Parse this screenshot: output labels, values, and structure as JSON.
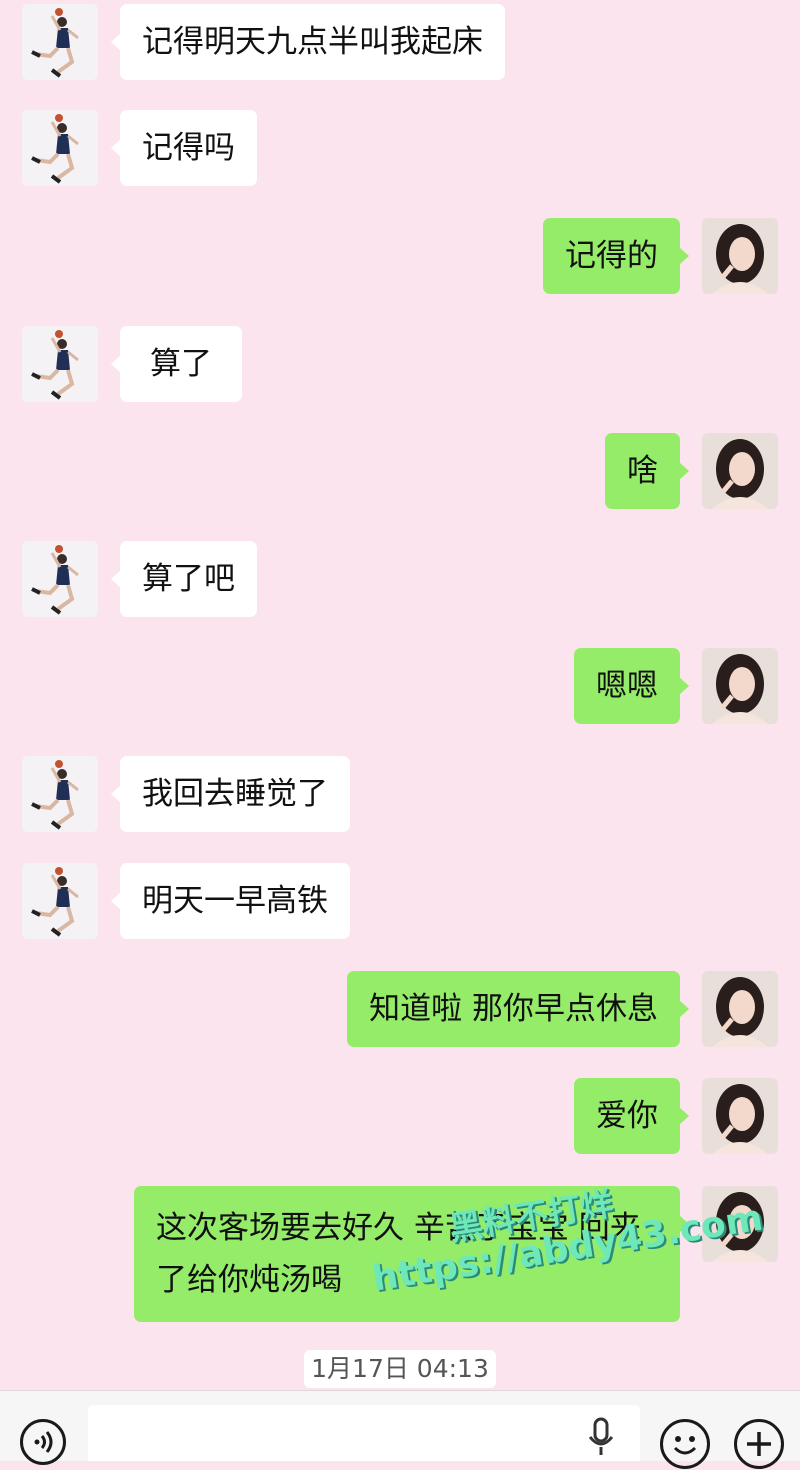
{
  "messages": [
    {
      "side": "left",
      "text": "记得明天九点半叫我起床"
    },
    {
      "side": "left",
      "text": "记得吗"
    },
    {
      "side": "right",
      "text": "记得的"
    },
    {
      "side": "left",
      "text": "算了"
    },
    {
      "side": "right",
      "text": "啥"
    },
    {
      "side": "left",
      "text": "算了吧"
    },
    {
      "side": "right",
      "text": "嗯嗯"
    },
    {
      "side": "left",
      "text": "我回去睡觉了"
    },
    {
      "side": "left",
      "text": "明天一早高铁"
    },
    {
      "side": "right",
      "text": "知道啦 那你早点休息"
    },
    {
      "side": "right",
      "text": "爱你"
    },
    {
      "side": "right",
      "text": "这次客场要去好久 辛苦了宝宝 回来了给你炖汤喝"
    }
  ],
  "timestamp": "1月17日 04:13",
  "watermark": {
    "line1": "黑料不打烊",
    "line2": "https://abdy43.com"
  },
  "input_bar": {
    "voice_icon": "voice-icon",
    "mic_icon": "microphone-icon",
    "emoji_icon": "emoji-icon",
    "plus_icon": "plus-icon"
  },
  "colors": {
    "background": "#fce4ef",
    "sent_bubble": "#95ec69",
    "received_bubble": "#ffffff"
  }
}
